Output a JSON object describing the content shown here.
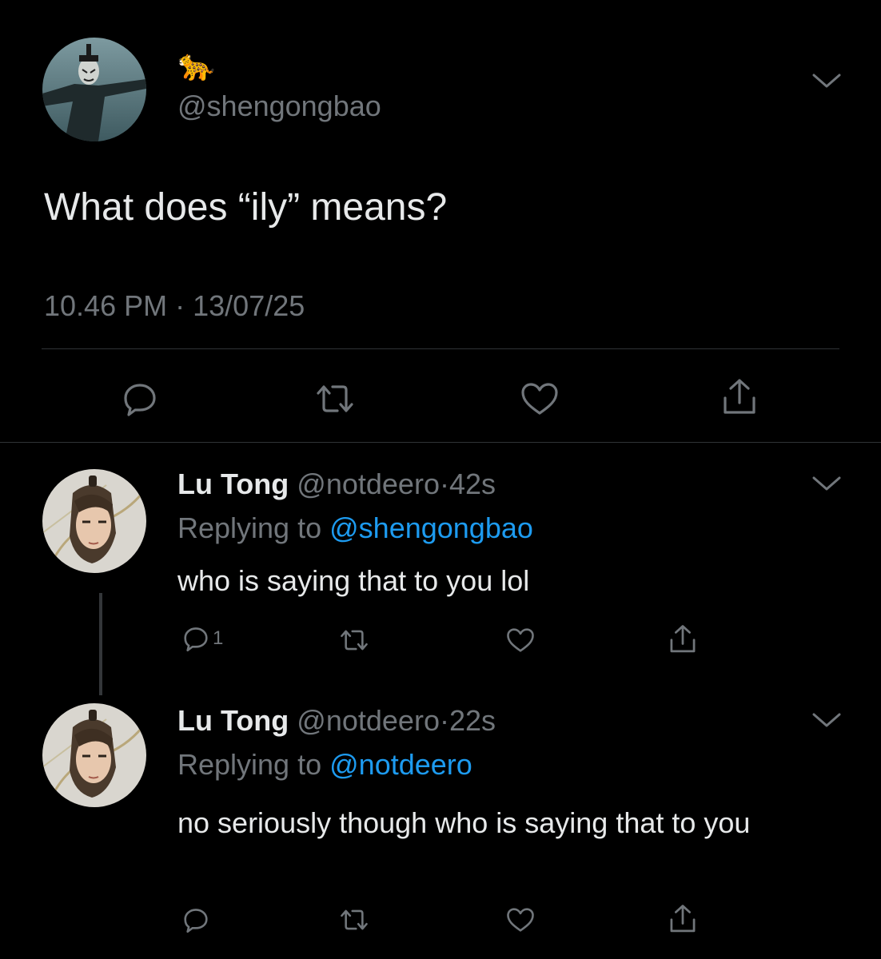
{
  "main_tweet": {
    "display_name_emoji": "🐆",
    "handle": "@shengongbao",
    "text": "What does “ily” means?",
    "time": "10.46 PM",
    "separator": "·",
    "date": "13/07/25",
    "avatar_icon": "avatar-shengongbao"
  },
  "replies": [
    {
      "name": "Lu Tong",
      "handle": "@notdeero",
      "separator": "·",
      "time": "42s",
      "replying_prefix": "Replying to",
      "replying_to": "@shengongbao",
      "text": "who is saying that to you lol",
      "reply_count": "1"
    },
    {
      "name": "Lu Tong",
      "handle": "@notdeero",
      "separator": "·",
      "time": "22s",
      "replying_prefix": "Replying to",
      "replying_to": "@notdeero",
      "text": "no seriously though who is saying that to you",
      "reply_count": ""
    }
  ],
  "icons": {
    "reply": "reply-icon",
    "retweet": "retweet-icon",
    "like": "heart-icon",
    "share": "share-icon",
    "more": "chevron-down-icon"
  },
  "colors": {
    "background": "#000000",
    "text": "#e7e9ea",
    "muted": "#71767b",
    "link": "#1d9bf0",
    "divider": "#2f3336"
  }
}
